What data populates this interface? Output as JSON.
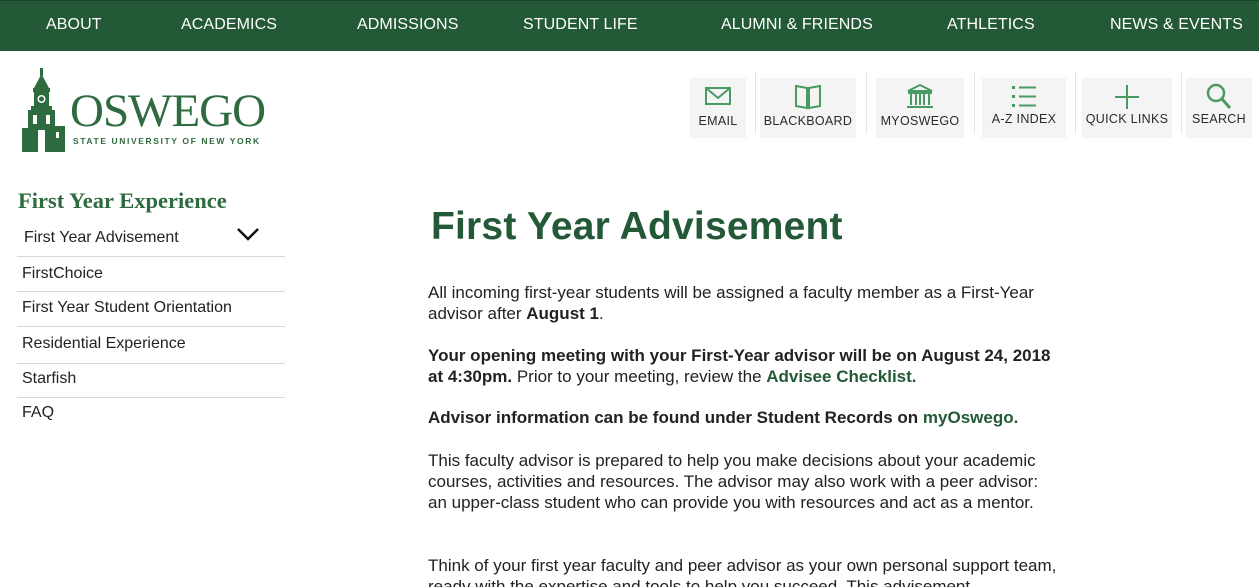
{
  "nav": {
    "about": "ABOUT",
    "academics": "ACADEMICS",
    "admissions": "ADMISSIONS",
    "student_life": "STUDENT LIFE",
    "alumni": "ALUMNI & FRIENDS",
    "athletics": "ATHLETICS",
    "news": "NEWS & EVENTS"
  },
  "logo": {
    "word": "OSWEGO",
    "sub": "STATE UNIVERSITY OF NEW YORK"
  },
  "utility": {
    "email": "EMAIL",
    "blackboard": "BLACKBOARD",
    "myoswego": "MYOSWEGO",
    "az_index": "A-Z INDEX",
    "quick_links": "QUICK LINKS",
    "search": "SEARCH"
  },
  "sidebar": {
    "title": "First Year Experience",
    "items": [
      {
        "label": "First Year Advisement"
      },
      {
        "label": "FirstChoice"
      },
      {
        "label": "First Year Student Orientation"
      },
      {
        "label": "Residential Experience"
      },
      {
        "label": "Starfish"
      },
      {
        "label": "FAQ"
      }
    ]
  },
  "main": {
    "title": "First Year Advisement",
    "p1_a": "All incoming first-year students will be assigned a faculty member as a First-Year advisor after ",
    "p1_b": "August 1",
    "p1_c": ".",
    "p2_a": "Your opening meeting with your First-Year advisor will be on August 24, 2018 at 4:30pm.",
    "p2_b": " Prior to your meeting, review the ",
    "p2_link": "Advisee Checklist",
    "p2_c": ".",
    "p3_a": "Advisor information can be found under Student Records on ",
    "p3_link": "myOswego",
    "p3_c": ".",
    "p4": "This faculty advisor is prepared to help you make decisions about your academic courses, activities and resources. The advisor may also work with a peer advisor: an upper-class student who can provide you with resources and act as a mentor.",
    "p5": "Think of your first year faculty and peer advisor as your own personal support team, ready with the expertise and tools to help you succeed.  This advisement"
  },
  "colors": {
    "brand_green": "#235937",
    "icon_green": "#4a9a63"
  }
}
